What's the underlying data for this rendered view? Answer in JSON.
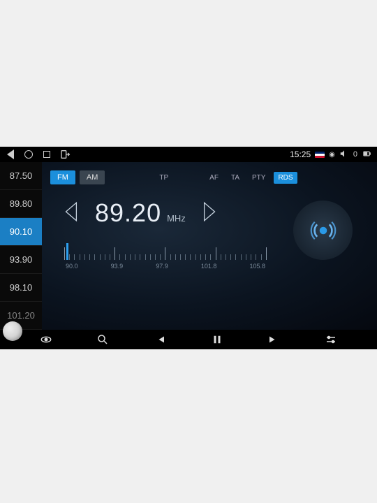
{
  "status": {
    "time": "15:25",
    "volume": "0"
  },
  "presets": [
    {
      "freq": "87.50",
      "active": false
    },
    {
      "freq": "89.80",
      "active": false
    },
    {
      "freq": "90.10",
      "active": true
    },
    {
      "freq": "93.90",
      "active": false
    },
    {
      "freq": "98.10",
      "active": false
    },
    {
      "freq": "101.20",
      "active": false
    }
  ],
  "bands": {
    "fm": "FM",
    "am": "AM"
  },
  "rds": {
    "tp": "TP",
    "af": "AF",
    "ta": "TA",
    "pty": "PTY",
    "rds": "RDS"
  },
  "tuner": {
    "frequency": "89.20",
    "unit": "MHz"
  },
  "dial": {
    "labels": [
      "90.0",
      "93.9",
      "97.9",
      "101.8",
      "105.8"
    ]
  },
  "colors": {
    "accent": "#1b8fdc"
  }
}
